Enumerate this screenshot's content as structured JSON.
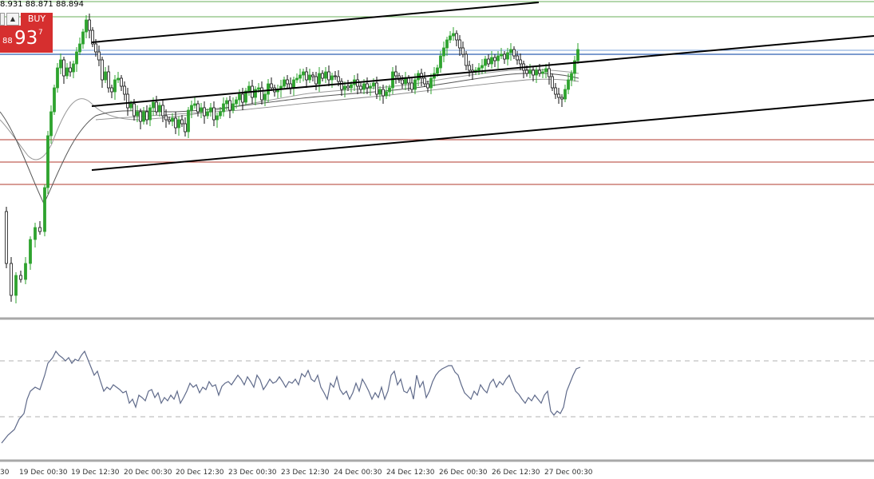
{
  "ohlc_readout": "8.931 88.871 88.894",
  "trade_panel": {
    "buy_label": "BUY",
    "price_small": "88",
    "price_big": "93",
    "price_sup": "7",
    "arrow_glyph": "▲"
  },
  "colors": {
    "bull": "#2ea32e",
    "bear": "#111111",
    "trendline": "#000000",
    "support_resistance": "#b03a2e",
    "top_level": "#6aaf5a",
    "blue_level": "#2f5fb0",
    "ma_light": "#9a9a9a",
    "ma_dark": "#555555",
    "oscillator": "#5f6a8a",
    "buy_button": "#d62f2f"
  },
  "chart_data": {
    "type": "candlestick",
    "xaxis_ticks": [
      "19 Dec 00:30",
      "19 Dec 12:30",
      "20 Dec 00:30",
      "20 Dec 12:30",
      "23 Dec 00:30",
      "23 Dec 12:30",
      "24 Dec 00:30",
      "24 Dec 12:30",
      "26 Dec 00:30",
      "26 Dec 12:30",
      "27 Dec 00:30"
    ],
    "xaxis_first_tick_partial": "30",
    "grid": false,
    "indicator_panel": {
      "type": "oscillator",
      "levels_dashed": 2
    }
  }
}
